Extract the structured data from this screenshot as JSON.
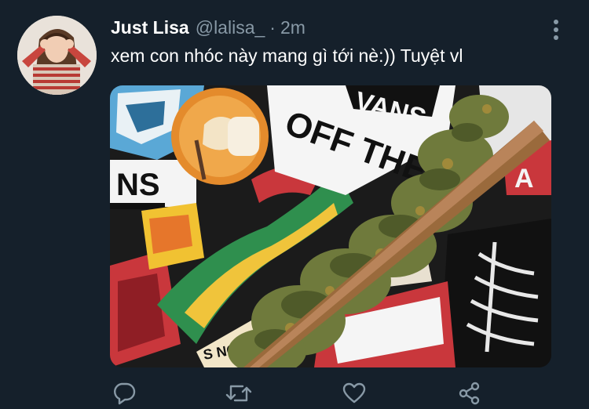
{
  "tweet": {
    "display_name": "Just Lisa",
    "handle": "@lalisa_",
    "separator": "·",
    "time": "2m",
    "text": "xem con nhóc này mang gì tới nè:)) Tuyệt vl"
  },
  "icons": {
    "more": "more-vertical-icon",
    "reply": "reply-icon",
    "retweet": "retweet-icon",
    "like": "heart-icon",
    "share": "share-icon"
  },
  "colors": {
    "background": "#15202b",
    "primary_text": "#ffffff",
    "secondary_text": "#8899a6"
  }
}
